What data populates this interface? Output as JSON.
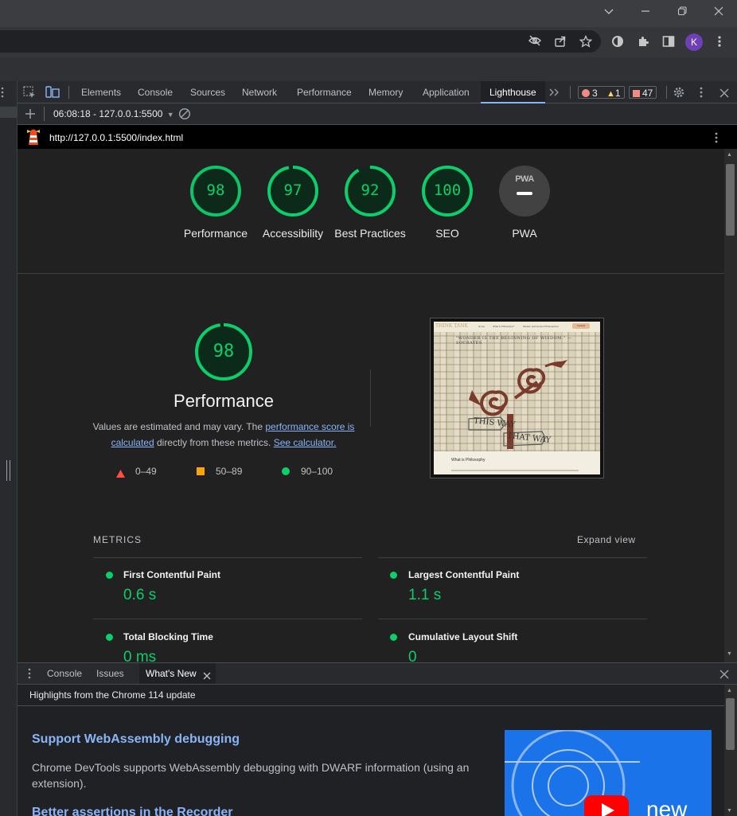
{
  "window": {
    "controls": [
      "chevron-down",
      "minimize",
      "restore",
      "close"
    ]
  },
  "avatar": {
    "initial": "K"
  },
  "devtools": {
    "tabs": [
      "Elements",
      "Console",
      "Sources",
      "Network",
      "Performance",
      "Memory",
      "Application",
      "Lighthouse"
    ],
    "active_tab": "Lighthouse",
    "errors": "3",
    "warnings": "1",
    "issues": "47"
  },
  "lighthouse": {
    "run_selector": "06:08:18 - 127.0.0.1:5500",
    "url": "http://127.0.0.1:5500/index.html",
    "summary_gauges": [
      {
        "score": "98",
        "label": "Performance"
      },
      {
        "score": "97",
        "label": "Accessibility"
      },
      {
        "score": "92",
        "label": "Best Practices"
      },
      {
        "score": "100",
        "label": "SEO"
      }
    ],
    "pwa": {
      "badge": "PWA",
      "label": "PWA"
    },
    "performance": {
      "score": "98",
      "title": "Performance",
      "desc_1": "Values are estimated and may vary. The ",
      "desc_link_1": "performance score is calculated",
      "desc_2": " directly from these metrics. ",
      "desc_link_2": "See calculator.",
      "legend": {
        "fail": "0–49",
        "average": "50–89",
        "pass": "90–100"
      }
    },
    "screenshot": {
      "site_name": "THINK TANK",
      "nav": [
        "Home",
        "What is Philosophy?",
        "Modern and Ancient Philosophers",
        "Contact"
      ],
      "quote": "\"WONDER IS THE BEGINNING OF WISDOM.\" — SOCRATES",
      "sign_1": "THIS WAY",
      "sign_2": "THAT WAY",
      "section": "What is Philosophy"
    },
    "metrics_heading": "METRICS",
    "expand_view": "Expand view",
    "metrics": [
      {
        "name": "First Contentful Paint",
        "value": "0.6 s"
      },
      {
        "name": "Largest Contentful Paint",
        "value": "1.1 s"
      },
      {
        "name": "Total Blocking Time",
        "value": "0 ms"
      },
      {
        "name": "Cumulative Layout Shift",
        "value": "0"
      }
    ]
  },
  "drawer": {
    "tabs": [
      "Console",
      "Issues",
      "What's New"
    ],
    "highlights": "Highlights from the Chrome 114 update",
    "items": [
      {
        "title": "Support WebAssembly debugging",
        "body": "Chrome DevTools supports WebAssembly debugging with DWARF information (using an extension)."
      },
      {
        "title": "Better assertions in the Recorder"
      }
    ],
    "video_text": "new"
  },
  "colors": {
    "pass": "#0cce6b",
    "average": "#ffa400",
    "fail": "#ff4e42",
    "link": "#8ab4f8"
  }
}
